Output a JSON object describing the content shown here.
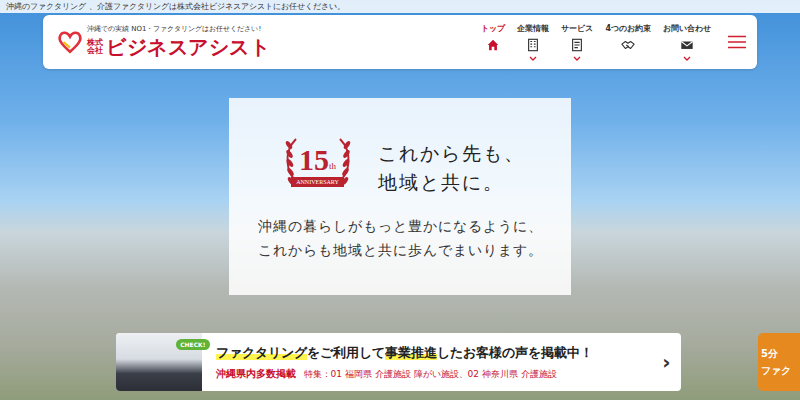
{
  "top_bar": {
    "text": "沖縄のファクタリング 、介護ファクタリングは株式会社ビジネスアシストにお任せください。"
  },
  "header": {
    "logo": {
      "tagline": "沖縄での実績 NO1・ファクタリングはお任せください!",
      "company_type": "株式会社",
      "name": "ビジネスアシスト"
    },
    "nav": [
      {
        "label": "トップ",
        "selected": true,
        "has_dropdown": false
      },
      {
        "label": "企業情報",
        "selected": false,
        "has_dropdown": true
      },
      {
        "label": "サービス",
        "selected": false,
        "has_dropdown": true
      },
      {
        "label": "4つのお約束",
        "selected": false,
        "has_dropdown": false
      },
      {
        "label": "お問い合わせ",
        "selected": false,
        "has_dropdown": true
      }
    ]
  },
  "hero": {
    "badge": {
      "number": "15",
      "suffix": "th",
      "ribbon": "ANNIVERSARY"
    },
    "headline": [
      "これから先も、",
      "地域と共に。"
    ],
    "lead": [
      "沖縄の暮らしがもっと豊かになるように、",
      "これからも地域と共に歩んでまいります。"
    ]
  },
  "banner": {
    "check": "CHECK!",
    "title_parts": [
      {
        "text": "ファクタリング",
        "highlight": true
      },
      {
        "text": "をご利用して",
        "highlight": false
      },
      {
        "text": "事業推進",
        "highlight": true
      },
      {
        "text": "したお客様の声を掲載中！",
        "highlight": false
      }
    ],
    "subtitle": "沖縄県内多数掲載",
    "feature": "特集：01 福岡県 介護施設 障がい施設、02 神奈川県 介護施設",
    "arrow": "›"
  },
  "side_badge": {
    "lines": [
      "5分",
      "ファク"
    ]
  }
}
